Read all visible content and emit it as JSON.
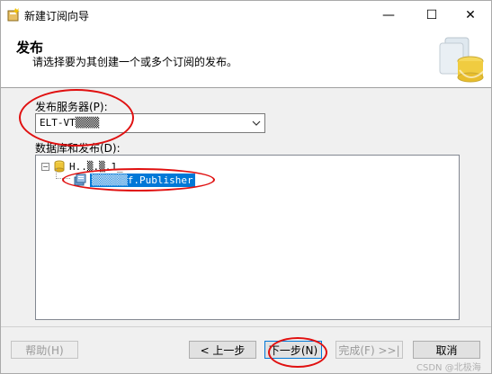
{
  "window": {
    "title": "新建订阅向导",
    "min_glyph": "—",
    "max_glyph": "☐",
    "close_glyph": "✕"
  },
  "header": {
    "title": "发布",
    "description": "请选择要为其创建一个或多个订阅的发布。"
  },
  "publisher": {
    "label": "发布服务器(P):",
    "value": "ELT-VT▒▒▒▒"
  },
  "databases": {
    "label": "数据库和发布(D):",
    "server_node": "H..▒.▒.1_",
    "publication_node": "▒▒▒▒▒▒f.Publisher",
    "expander_glyph": "−"
  },
  "buttons": {
    "help": "帮助(H)",
    "back": "< 上一步",
    "next": "下一步(N)",
    "finish": "完成(F) >>|",
    "cancel": "取消"
  },
  "watermark": "CSDN @北极海heir",
  "colors": {
    "selection": "#0078d7",
    "annotation": "#e01010"
  }
}
